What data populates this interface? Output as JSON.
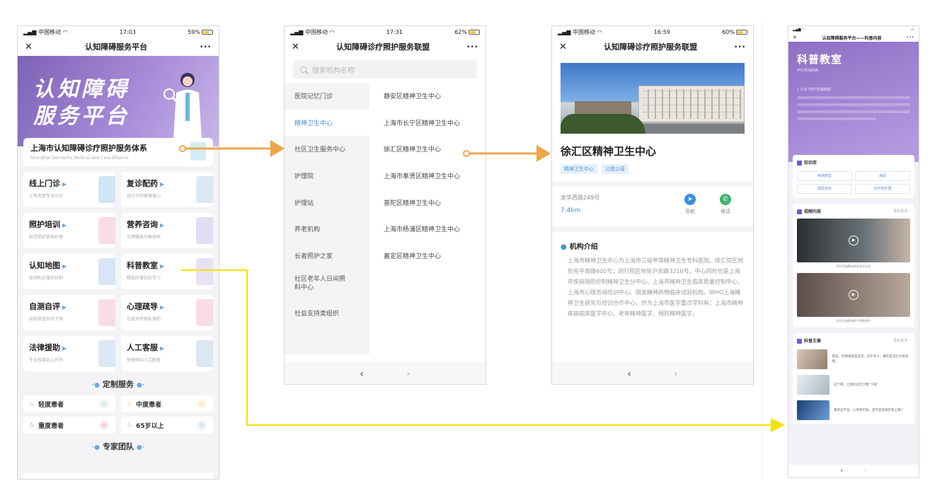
{
  "p1": {
    "status": {
      "carrier": "中国移动",
      "time": "17:03",
      "battery": "59%"
    },
    "nav": {
      "close": "✕",
      "title": "认知障碍服务平台",
      "more": "···"
    },
    "hero": {
      "line1": "认知障碍",
      "line2": "服务平台"
    },
    "banner": {
      "title": "上海市认知障碍诊疗照护服务体系",
      "subtitle": "Shanghai Dementia Medical and Care Alliance"
    },
    "cards": [
      {
        "title": "线上门诊",
        "sub": "三甲名医专业问诊",
        "color": "#cfe6f5"
      },
      {
        "title": "复诊配药",
        "sub": "线方开药便捷省心",
        "color": "#d9e9f6"
      },
      {
        "title": "照护培训",
        "sub": "科学照护提高护理",
        "color": "#f8dbe6"
      },
      {
        "title": "营养咨询",
        "sub": "合理膳食均衡营养",
        "color": "#e3def5"
      },
      {
        "title": "认知地图",
        "sub": "查询附近服务机构",
        "color": "#d7e5f7"
      },
      {
        "title": "科普教室",
        "sub": "精选好课轻松学习",
        "color": "#e9e0f6"
      },
      {
        "title": "自测自评",
        "sub": "自我筛查及时干预",
        "color": "#f7dce7"
      },
      {
        "title": "心理疏导",
        "sub": "在线关怀隐私保护",
        "color": "#f8dde8"
      },
      {
        "title": "法律援助",
        "sub": "专业权威安心托付",
        "color": "#dbe8f6"
      },
      {
        "title": "人工客服",
        "sub": "快速响应人工解答",
        "color": "#dde7f4"
      }
    ],
    "section1": "定制服务",
    "custom": [
      {
        "label": "轻度患者",
        "flame": "#6aa9e8",
        "rc": "#e8f6ee",
        "rt": "#8fd3a8"
      },
      {
        "label": "中度患者",
        "flame": "#f0a43a",
        "rc": "#fdf3d9",
        "rt": "#f0c24a"
      },
      {
        "label": "重度患者",
        "flame": "#e8544e",
        "rc": "#fde4e8",
        "rt": "#f07a92"
      },
      {
        "label": "65岁以上",
        "flame": "#6aa9e8",
        "rc": "#e6eefb",
        "rt": "#8fb0ea"
      }
    ],
    "section2": "专家团队"
  },
  "p2": {
    "status": {
      "carrier": "中国移动",
      "time": "17:31",
      "battery": "62%"
    },
    "nav": {
      "close": "✕",
      "title": "认知障碍诊疗照护服务联盟",
      "more": "···"
    },
    "search_placeholder": "搜索机构名称",
    "categories": [
      "医院记忆门诊",
      "精神卫生中心",
      "社区卫生服务中心",
      "护理院",
      "护理站",
      "养老机构",
      "长者照护之家",
      "社区老年人日间照料中心",
      "社会支持类组织"
    ],
    "institutions": [
      "静安区精神卫生中心",
      "上海市长宁区精神卫生中心",
      "徐汇区精神卫生中心",
      "上海市奉贤区精神卫生中心",
      "普陀区精神卫生中心",
      "上海市杨浦区精神卫生中心",
      "嘉定区精神卫生中心"
    ],
    "footer": {
      "back": "‹",
      "forward": "›"
    }
  },
  "p3": {
    "status": {
      "carrier": "中国移动",
      "time": "16:59",
      "battery": "60%"
    },
    "nav": {
      "close": "✕",
      "title": "认知障碍诊疗照护服务联盟",
      "more": "···"
    },
    "title": "徐汇区精神卫生中心",
    "tags": [
      "精神卫生中心",
      "公建公营"
    ],
    "address": "龙华西路249号",
    "distance": "7.4km",
    "actions": [
      {
        "label": "导航",
        "color": "#3a8ee6",
        "glyph": "➤"
      },
      {
        "label": "电话",
        "color": "#3cb371",
        "glyph": "✆"
      }
    ],
    "intro_title": "机构介绍",
    "intro_text": "上海市精神卫生中心为上海市三级甲等精神卫生专科医院。徐汇院区地处宛平南路600号；闵行院区地处沪闵路3210号。中心同时也是上海市疾病预防控制精神卫生分中心、上海市精神卫生临床质量控制中心、上海市心理咨询培训中心、国家精神药物临床试验机构、WHO上海精神卫生研究与培训合作中心。作为上海市医学重点学科有：上海市精神疾病临床医学中心、老年精神医学、预防精神医学。",
    "footer": {
      "back": "‹",
      "forward": "›"
    }
  },
  "p4": {
    "nav": {
      "close": "✕",
      "title": "认知障碍服务平台——科普内容",
      "more": "···"
    },
    "hero_title": "科普教室",
    "hero_sub": "阿尔茨海默病",
    "hero_block": "• 认识“阿尔茨海默病”",
    "knowledge_title": "知识库",
    "knowledge_items": [
      "疾病类型",
      "病因",
      "典型症状",
      "治疗和护理"
    ],
    "video_title": "视频内容",
    "video_more": "查看更多 ›",
    "video_caps": [
      "阿尔茨海默病早发现早诊治",
      "阿尔茨海默病的干预和照护"
    ],
    "article_title": "科普文章",
    "article_more": "查看更多 ›",
    "articles": [
      "刚说，对我来说是这次。对于老人，确实是记忆力衰退啊。",
      "这个病，让他的记忆力慢“下班”",
      "我的记不住，心慌胃不知，是不是老痴在找上我？"
    ],
    "footer": {
      "back": "‹",
      "forward": "›"
    }
  }
}
